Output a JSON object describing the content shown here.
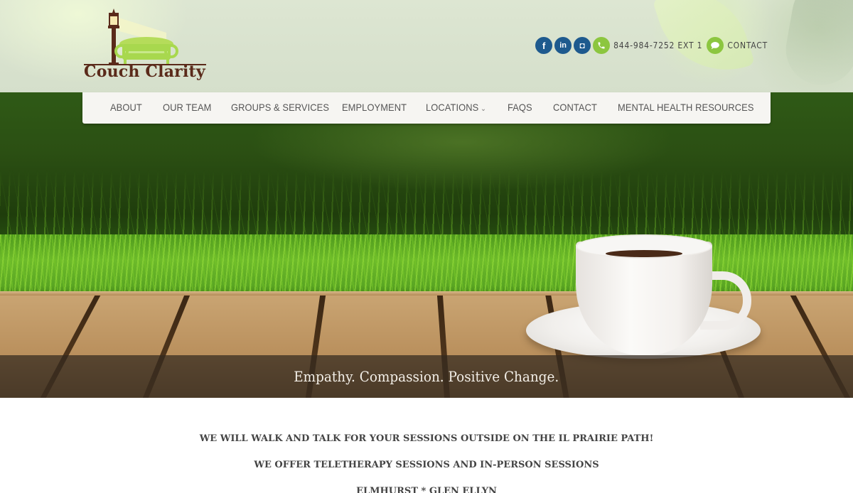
{
  "brand": {
    "name": "Couch Clarity",
    "colors": {
      "logo_brown": "#5a2a1a",
      "logo_green": "#a8d84e",
      "social_blue": "#1e5a8e",
      "accent_green": "#8cc63f",
      "nav_bg": "#f6f5f2"
    }
  },
  "topbar": {
    "social": [
      {
        "name": "facebook",
        "icon": "facebook-icon",
        "glyph": "f"
      },
      {
        "name": "linkedin",
        "icon": "linkedin-icon",
        "glyph": "in"
      },
      {
        "name": "instagram",
        "icon": "instagram-icon",
        "glyph": "◘"
      }
    ],
    "phone_icon": "phone-icon",
    "phone": "844-984-7252 EXT 1",
    "contact_icon": "chat-bubble-icon",
    "contact_label": "CONTACT"
  },
  "nav": {
    "items": [
      {
        "label": "ABOUT"
      },
      {
        "label": "OUR TEAM"
      },
      {
        "label": "GROUPS & SERVICES"
      },
      {
        "label": "EMPLOYMENT"
      },
      {
        "label": "LOCATIONS",
        "has_dropdown": true
      },
      {
        "label": "FAQS"
      },
      {
        "label": "CONTACT"
      },
      {
        "label": "MENTAL HEALTH RESOURCES"
      }
    ],
    "dropdown_glyph": "⌄"
  },
  "hero": {
    "tagline": "Empathy. Compassion. Positive Change."
  },
  "content": {
    "lines": [
      "WE WILL WALK AND TALK FOR YOUR SESSIONS OUTSIDE ON THE IL PRAIRIE PATH!",
      "WE OFFER TELETHERAPY SESSIONS AND IN-PERSON SESSIONS",
      "ELMHURST * GLEN ELLYN"
    ]
  }
}
